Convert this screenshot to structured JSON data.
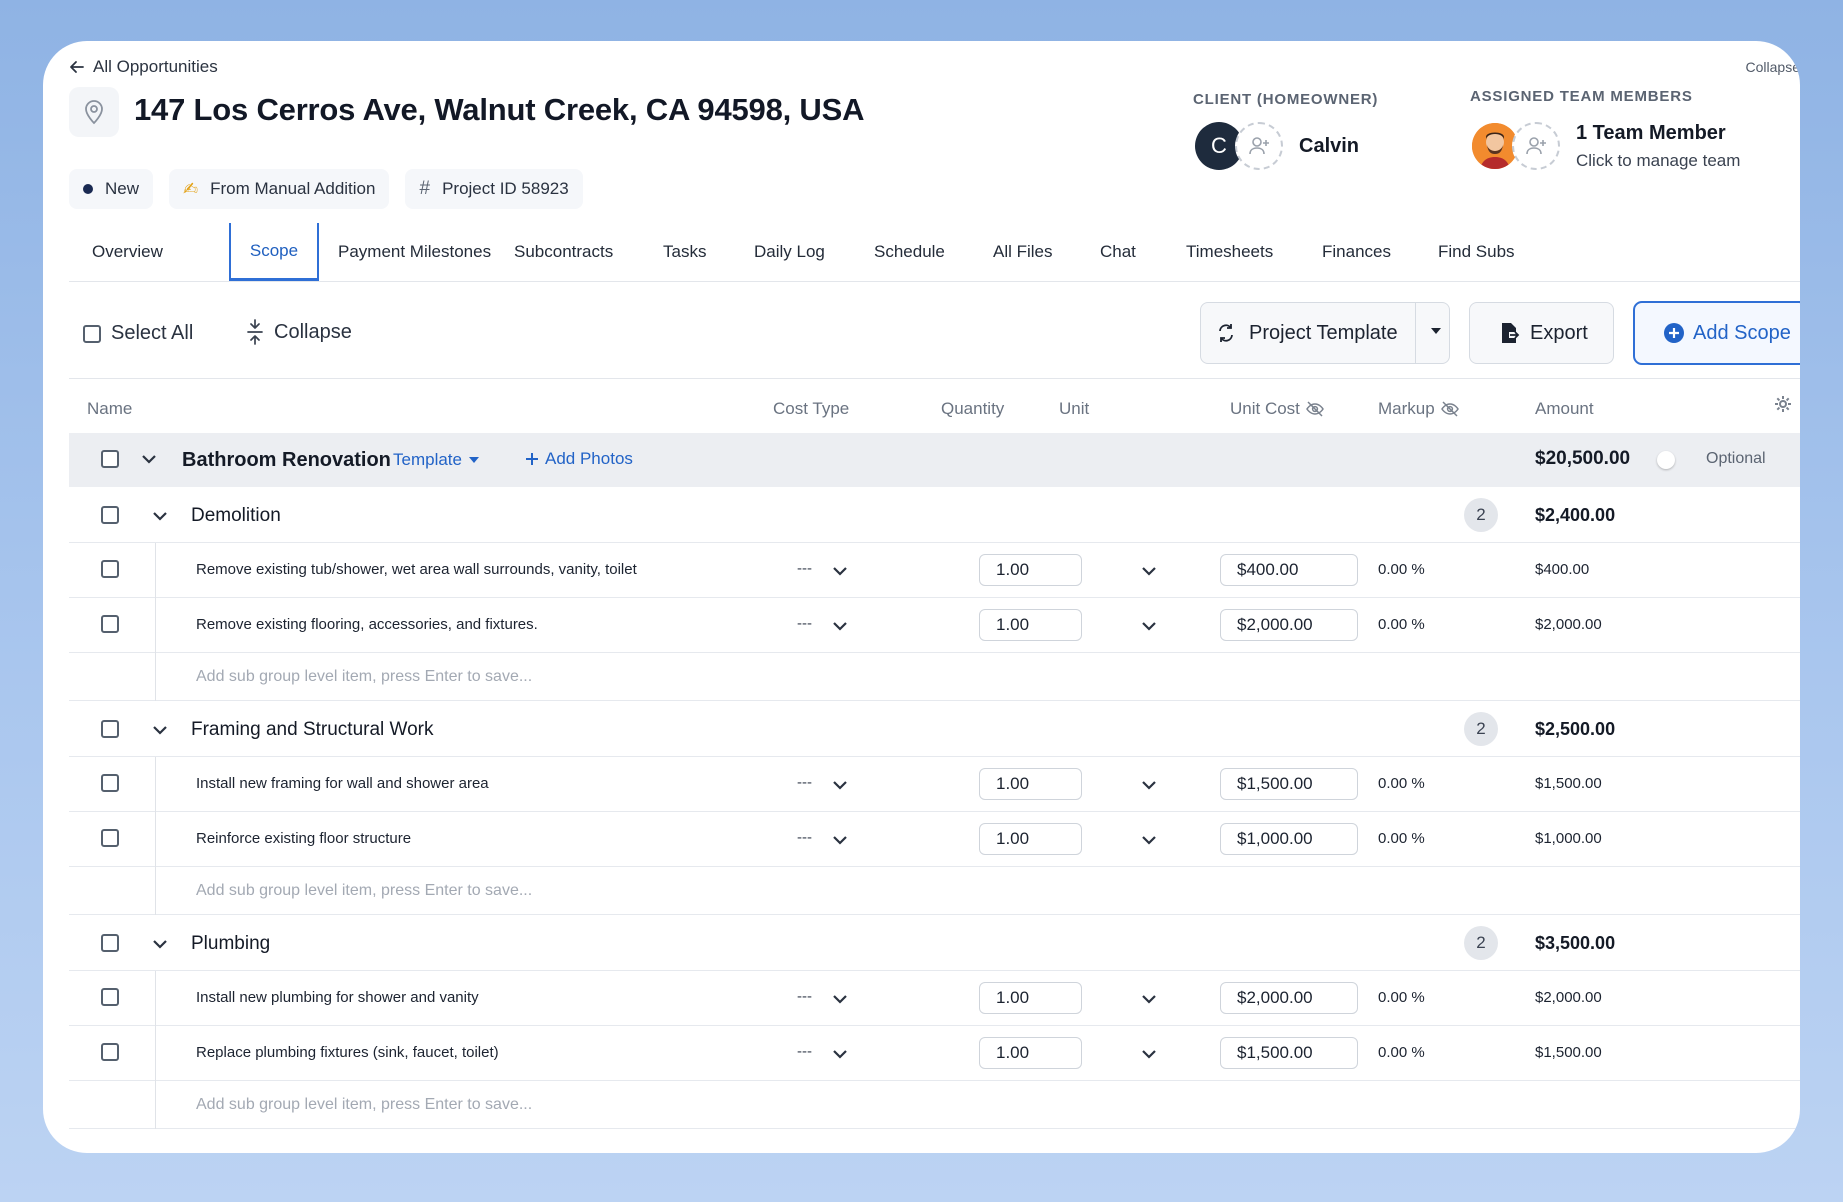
{
  "header": {
    "back_label": "All Opportunities",
    "title": "147 Los Cerros Ave, Walnut Creek, CA 94598, USA",
    "collapse_label": "Collapse",
    "chips": [
      {
        "label": "New",
        "icon": "status-dot"
      },
      {
        "label": "From Manual Addition",
        "icon": "hand-writing-icon"
      },
      {
        "label": "Project ID 58923",
        "icon": "hash-icon"
      }
    ],
    "client": {
      "label": "CLIENT (HOMEOWNER)",
      "initial": "C",
      "name": "Calvin"
    },
    "team": {
      "label": "ASSIGNED TEAM MEMBERS",
      "count_label": "1 Team Member",
      "sub_label": "Click to manage team"
    }
  },
  "tabs": [
    {
      "label": "Overview",
      "active": false
    },
    {
      "label": "Scope",
      "active": true
    },
    {
      "label": "Payment Milestones",
      "active": false
    },
    {
      "label": "Subcontracts",
      "active": false
    },
    {
      "label": "Tasks",
      "active": false
    },
    {
      "label": "Daily Log",
      "active": false
    },
    {
      "label": "Schedule",
      "active": false
    },
    {
      "label": "All Files",
      "active": false
    },
    {
      "label": "Chat",
      "active": false
    },
    {
      "label": "Timesheets",
      "active": false
    },
    {
      "label": "Finances",
      "active": false
    },
    {
      "label": "Find Subs",
      "active": false
    }
  ],
  "toolbar": {
    "select_all": "Select All",
    "collapse": "Collapse",
    "project_template": "Project Template",
    "export": "Export",
    "add_scope": "Add Scope"
  },
  "columns": {
    "name": "Name",
    "cost_type": "Cost Type",
    "quantity": "Quantity",
    "unit": "Unit",
    "unit_cost": "Unit Cost",
    "markup": "Markup",
    "amount": "Amount"
  },
  "scope": {
    "name": "Bathroom Renovation",
    "template_label": "Template",
    "add_photos_label": "Add Photos",
    "amount": "$20,500.00",
    "optional_label": "Optional",
    "groups": [
      {
        "name": "Demolition",
        "count": "2",
        "amount": "$2,400.00",
        "items": [
          {
            "name": "Remove existing tub/shower, wet area wall surrounds, vanity, toilet",
            "cost_type": "---",
            "quantity": "1.00",
            "unit_cost": "$400.00",
            "markup": "0.00 %",
            "amount": "$400.00"
          },
          {
            "name": "Remove existing flooring, accessories, and fixtures.",
            "cost_type": "---",
            "quantity": "1.00",
            "unit_cost": "$2,000.00",
            "markup": "0.00 %",
            "amount": "$2,000.00"
          }
        ],
        "add_placeholder": "Add sub group level item, press Enter to save..."
      },
      {
        "name": "Framing and Structural Work",
        "count": "2",
        "amount": "$2,500.00",
        "items": [
          {
            "name": "Install new framing for wall and shower area",
            "cost_type": "---",
            "quantity": "1.00",
            "unit_cost": "$1,500.00",
            "markup": "0.00 %",
            "amount": "$1,500.00"
          },
          {
            "name": "Reinforce existing floor structure",
            "cost_type": "---",
            "quantity": "1.00",
            "unit_cost": "$1,000.00",
            "markup": "0.00 %",
            "amount": "$1,000.00"
          }
        ],
        "add_placeholder": "Add sub group level item, press Enter to save..."
      },
      {
        "name": "Plumbing",
        "count": "2",
        "amount": "$3,500.00",
        "items": [
          {
            "name": "Install new plumbing for shower and vanity",
            "cost_type": "---",
            "quantity": "1.00",
            "unit_cost": "$2,000.00",
            "markup": "0.00 %",
            "amount": "$2,000.00"
          },
          {
            "name": "Replace plumbing fixtures (sink, faucet, toilet)",
            "cost_type": "---",
            "quantity": "1.00",
            "unit_cost": "$1,500.00",
            "markup": "0.00 %",
            "amount": "$1,500.00"
          }
        ],
        "add_placeholder": "Add sub group level item, press Enter to save..."
      }
    ]
  },
  "colors": {
    "accent": "#2f6fd6",
    "background": "#a9c6ee",
    "group_row": "#eceef2"
  }
}
